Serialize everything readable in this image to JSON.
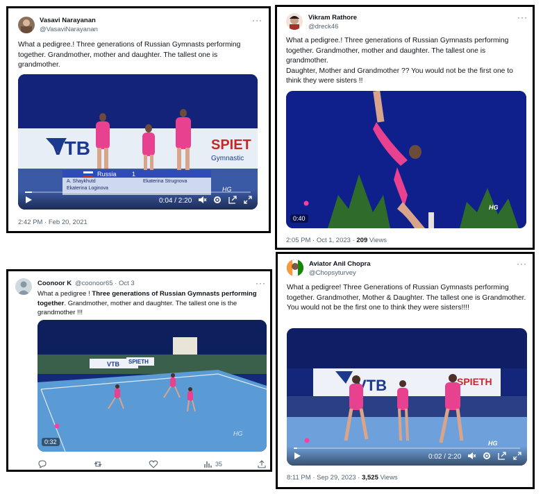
{
  "tweets": [
    {
      "name": "Vasavi Narayanan",
      "handle": "@VasaviNarayanan",
      "more": "···",
      "text": [
        "What a pedigree.!  Three generations of Russian Gymnasts performing together. Grandmother, mother and daughter. The tallest one is grandmother."
      ],
      "video_time": "0:04 / 2:20",
      "scoreboard": {
        "country": "Russia",
        "score": "1",
        "names": [
          "A. Shaykhutd",
          "Ekaterina Strugnova",
          "Ekaterina Loginova"
        ]
      },
      "sponsors": [
        "VTB",
        "SPIET",
        "Gymnastic"
      ],
      "watermark": "HG",
      "timestamp": "2:42 PM · Feb 20, 2021"
    },
    {
      "name": "Vikram Rathore",
      "handle": "@dreck46",
      "more": "···",
      "text": [
        "What a pedigree.! Three generations of Russian Gymnasts performing together. Grandmother, mother and daughter. The tallest one is grandmother.",
        "Daughter, Mother and Grandmother   ??  You would not be the first one to think they were sisters  !!"
      ],
      "video_duration": "0:40",
      "watermark": "HG",
      "timestamp": "2:05 PM · Oct 1, 2023 · ",
      "views_count": "209",
      "views_label": " Views"
    },
    {
      "name": "Coonoor K",
      "handle": "@coonoor65 · Oct 3",
      "more": "···",
      "text_prefix": "What a pedigree ! ",
      "text_bold": "Three generations of Russian Gymnasts performing together",
      "text_suffix": ". Grandmother, mother and daughter. The tallest one is the grandmother !!!",
      "video_duration": "0:32",
      "sponsors": [
        "VTB",
        "SPIETH"
      ],
      "watermark": "HG",
      "views": "35"
    },
    {
      "name": "Aviator Anil Chopra",
      "handle": "@Chopsyturvey",
      "more": "···",
      "text": [
        "What a pedigree! Three Generations of Russian Gymnasts performing together. Grandmother, Mother & Daughter. The tallest one is Grandmother.",
        "You would not be the first one to think they were sisters!!!!"
      ],
      "video_time": "0:02 / 2:20",
      "sponsors": [
        "VTB",
        "SPIETH"
      ],
      "watermark": "HG",
      "timestamp": "8:11 PM · Sep 29, 2023 · ",
      "views_count": "3,525",
      "views_label": " Views"
    }
  ],
  "colors": {
    "border": "#000000",
    "text": "#0f1419",
    "muted": "#536471",
    "video_blue": "#0d1f6b",
    "leotard": "#e8418f",
    "floor": "#5b9bd5"
  }
}
